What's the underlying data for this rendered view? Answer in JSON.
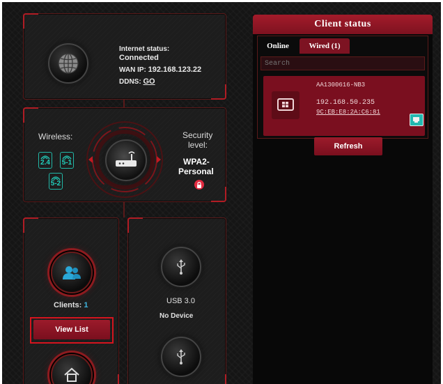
{
  "network_map": {
    "internet": {
      "status_label": "Internet status:",
      "status_value": "Connected",
      "wan_label": "WAN IP:",
      "wan_value": "192.168.123.22",
      "ddns_label": "DDNS:",
      "ddns_link": "GO",
      "icon": "globe-icon"
    },
    "router": {
      "wireless_label": "Wireless:",
      "bands": [
        "2.4",
        "5-1",
        "5-2"
      ],
      "security_label_line1": "Security",
      "security_label_line2": "level:",
      "security_value_line1": "WPA2-",
      "security_value_line2": "Personal",
      "icon": "router-icon",
      "lock_icon": "lock-icon"
    },
    "clients": {
      "label": "Clients:",
      "count": "1",
      "view_list_label": "View List",
      "icon": "users-icon"
    },
    "usb": {
      "port1_label": "USB 3.0",
      "port1_status": "No Device",
      "icon": "usb-icon"
    }
  },
  "client_status": {
    "title": "Client status",
    "tabs": [
      {
        "label": "Online",
        "active": false
      },
      {
        "label": "Wired (1)",
        "active": true
      }
    ],
    "search_placeholder": "Search",
    "clients": [
      {
        "name": "AA1300616-NB3",
        "ip": "192.168.50.235",
        "mac": "9C:EB:E8:2A:C6:81",
        "device_icon": "windows-device-icon",
        "connection_icon": "wired-connection-icon"
      }
    ],
    "refresh_label": "Refresh"
  },
  "colors": {
    "accent": "#9c1b2b",
    "wifi": "#22b8a8",
    "client_count": "#3fb6e0"
  }
}
